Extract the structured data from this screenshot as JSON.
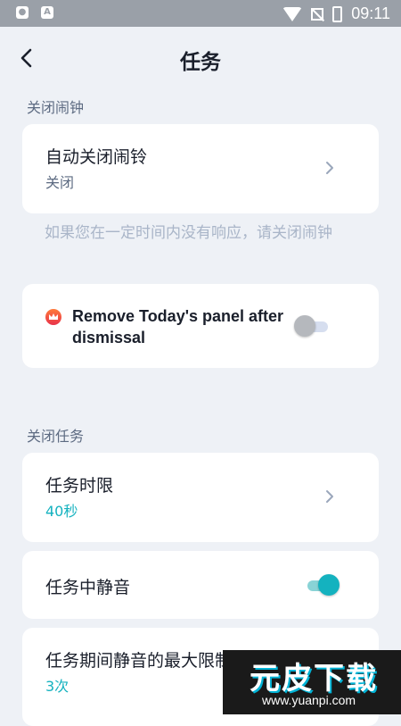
{
  "status_bar": {
    "time": "09:11",
    "left_icons": [
      "shield-icon",
      "a-box-icon"
    ],
    "right_icons": [
      "wifi-icon",
      "no-signal-icon",
      "battery-charging-icon"
    ]
  },
  "header": {
    "title": "任务",
    "back_icon": "chevron-left-icon"
  },
  "close_alarm_section": {
    "title": "关闭闹钟",
    "auto_close": {
      "label": "自动关闭闹铃",
      "value": "关闭"
    },
    "note": "如果您在一定时间内没有响应，请关闭闹钟",
    "remove_panel": {
      "label": "Remove Today's panel after dismissal",
      "enabled": false,
      "premium_icon": "crown-icon"
    }
  },
  "close_task_section": {
    "title": "关闭任务",
    "time_limit": {
      "label": "任务时限",
      "value": "40秒"
    },
    "mute_during_task": {
      "label": "任务中静音",
      "enabled": true
    },
    "max_mute": {
      "label": "任务期间静音的最大限制",
      "value": "3次"
    }
  },
  "watermark": {
    "brand": "元皮下载",
    "url": "www.yuanpi.com"
  },
  "colors": {
    "background": "#eef1f6",
    "card": "#ffffff",
    "accent": "#14b2bf",
    "section_title": "#5d6b82",
    "muted_note": "#a9b5c8"
  }
}
